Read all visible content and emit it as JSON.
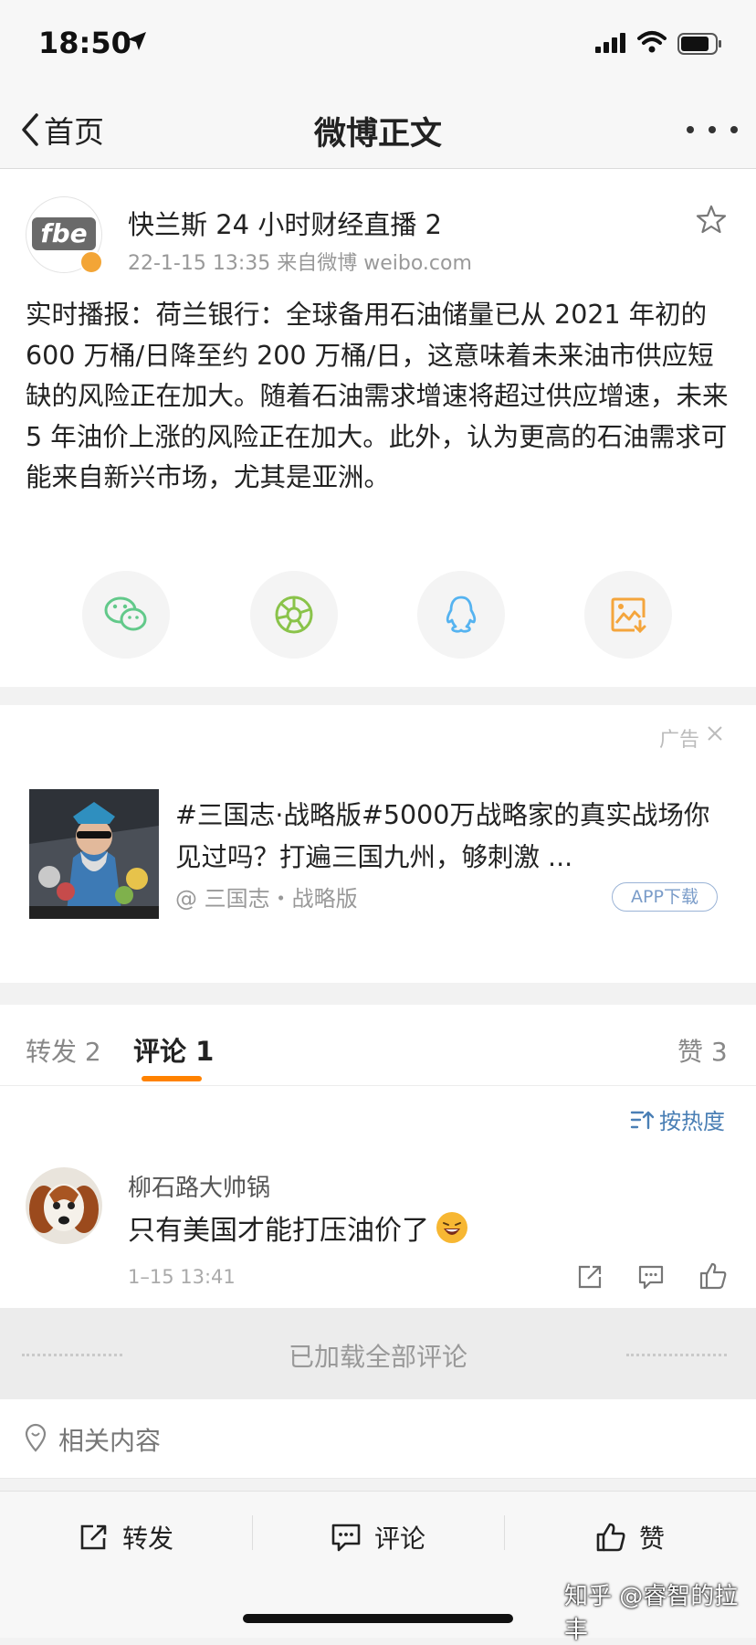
{
  "status_bar": {
    "time": "18:50"
  },
  "nav": {
    "back_label": "首页",
    "title": "微博正文"
  },
  "post": {
    "author": "快兰斯 24 小时财经直播 2",
    "avatar_text": "fbe",
    "meta": "22-1-15 13:35   来自微博 weibo.com",
    "text": "实时播报：荷兰银行：全球备用石油储量已从 2021 年初的 600 万桶/日降至约 200 万桶/日，这意味着未来油市供应短缺的风险正在加大。随着石油需求增速将超过供应增速，未来 5 年油价上涨的风险正在加大。此外，认为更高的石油需求可能来自新兴市场，尤其是亚洲。",
    "share_targets": [
      "wechat-icon",
      "moments-icon",
      "qq-icon",
      "save-image-icon"
    ]
  },
  "ad": {
    "label": "广告",
    "title": "#三国志·战略版#5000万战略家的真实战场你见过吗？打遍三国九州，够刺激 ...",
    "source": "@ 三国志・战略版",
    "download_label": "APP下载"
  },
  "comments_section": {
    "tab_repost": "转发 2",
    "tab_comment": "评论 1",
    "tab_like": "赞 3",
    "sort_label": "按热度",
    "comments": [
      {
        "user": "柳石路大帅锅",
        "text": "只有美国才能打压油价了",
        "time": "1–15 13:41"
      }
    ],
    "loaded_all": "已加载全部评论"
  },
  "related": {
    "label": "相关内容"
  },
  "bottom_bar": {
    "repost": "转发",
    "comment": "评论",
    "like": "赞"
  },
  "watermark": "知乎 @睿智的拉丰",
  "colors": {
    "accent": "#ff8200",
    "link_blue": "#4a7fb5",
    "wechat_green": "#62c98a",
    "qq_blue": "#55b3f0",
    "image_orange": "#f4a53c"
  }
}
